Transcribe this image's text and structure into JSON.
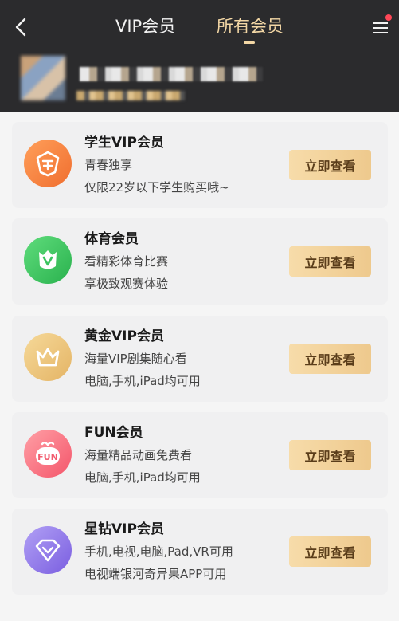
{
  "header": {
    "back_icon": "chevron-left-icon",
    "tabs": [
      {
        "label": "VIP会员",
        "active": false
      },
      {
        "label": "所有会员",
        "active": true
      }
    ],
    "menu_icon": "menu-icon",
    "colors": {
      "background": "#2b2b2d",
      "active_tab": "#f3d7a5"
    }
  },
  "memberships": [
    {
      "title": "学生VIP会员",
      "line1": "青春独享",
      "line2": "仅限22岁以下学生购买哦~",
      "button": "立即查看",
      "icon": "student-shield-icon",
      "color": "#f07f3f"
    },
    {
      "title": "体育会员",
      "line1": "看精彩体育比赛",
      "line2": "享极致观赛体验",
      "button": "立即查看",
      "icon": "sports-v-icon",
      "color": "#3bc45f"
    },
    {
      "title": "黄金VIP会员",
      "line1": "海量VIP剧集随心看",
      "line2": "电脑,手机,iPad均可用",
      "button": "立即查看",
      "icon": "gold-crown-icon",
      "color": "#e9c27a"
    },
    {
      "title": "FUN会员",
      "line1": "海量精品动画免费看",
      "line2": "电脑,手机,iPad均可用",
      "button": "立即查看",
      "icon": "fun-badge-icon",
      "color": "#f25b6e"
    },
    {
      "title": "星钻VIP会员",
      "line1": "手机,电视,电脑,Pad,VR可用",
      "line2": "电视端银河奇异果APP可用",
      "button": "立即查看",
      "icon": "diamond-icon",
      "color": "#8f74e8"
    }
  ]
}
